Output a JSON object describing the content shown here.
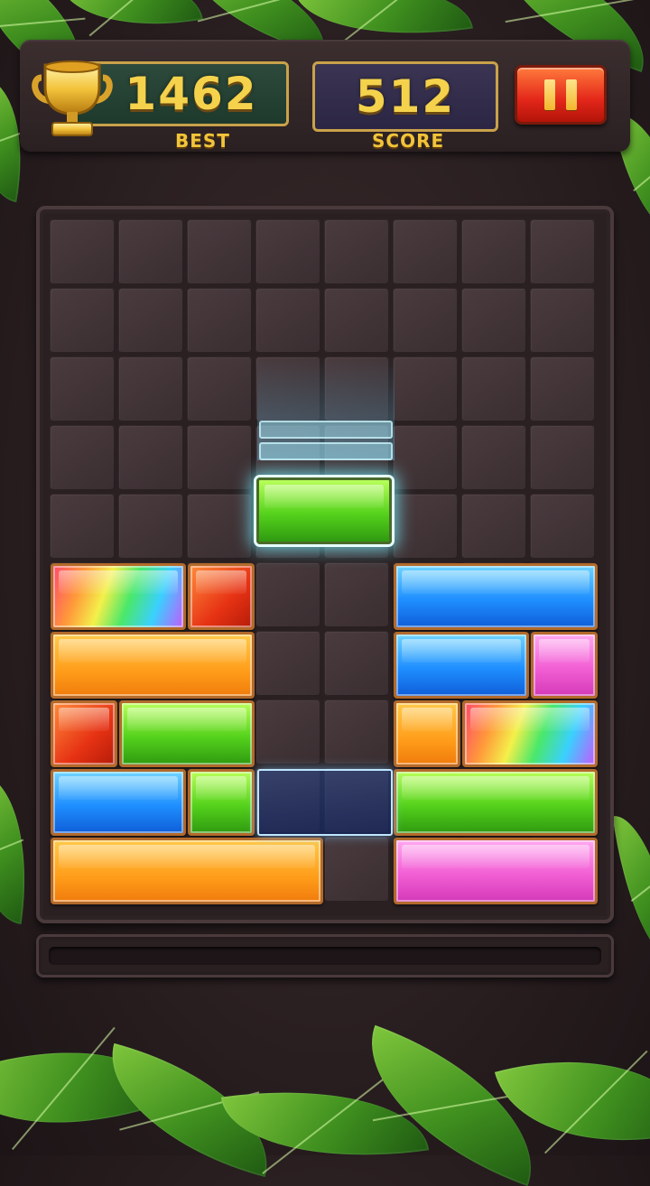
{
  "hud": {
    "best_value": "1462",
    "best_label": "BEST",
    "score_value": "512",
    "score_label": "SCORE"
  },
  "icons": {
    "trophy": "trophy-icon",
    "pause": "pause-icon"
  },
  "colors": {
    "accent_gold": "#f5d24c",
    "pause_red": "#e3261a",
    "board_bg": "#2a2022"
  },
  "board": {
    "columns": 8,
    "rows": 10,
    "falling_block": {
      "color": "green",
      "col": 3,
      "row": 3.75,
      "length": 2
    },
    "target_slot": {
      "col": 3,
      "row": 8,
      "length": 2
    },
    "blocks": [
      {
        "color": "rainbow",
        "col": 0,
        "row": 5,
        "length": 2
      },
      {
        "color": "red",
        "col": 2,
        "row": 5,
        "length": 1
      },
      {
        "color": "blue",
        "col": 5,
        "row": 5,
        "length": 3
      },
      {
        "color": "orange",
        "col": 0,
        "row": 6,
        "length": 3
      },
      {
        "color": "blue",
        "col": 5,
        "row": 6,
        "length": 2
      },
      {
        "color": "pink",
        "col": 7,
        "row": 6,
        "length": 1
      },
      {
        "color": "red",
        "col": 0,
        "row": 7,
        "length": 1
      },
      {
        "color": "green",
        "col": 1,
        "row": 7,
        "length": 2
      },
      {
        "color": "orange",
        "col": 5,
        "row": 7,
        "length": 1
      },
      {
        "color": "rainbow",
        "col": 6,
        "row": 7,
        "length": 2
      },
      {
        "color": "blue",
        "col": 0,
        "row": 8,
        "length": 2
      },
      {
        "color": "green",
        "col": 2,
        "row": 8,
        "length": 1
      },
      {
        "color": "green",
        "col": 5,
        "row": 8,
        "length": 3
      },
      {
        "color": "orange",
        "col": 0,
        "row": 9,
        "length": 4
      },
      {
        "color": "pink",
        "col": 5,
        "row": 9,
        "length": 3
      }
    ]
  },
  "progress": {
    "fraction": 0
  }
}
